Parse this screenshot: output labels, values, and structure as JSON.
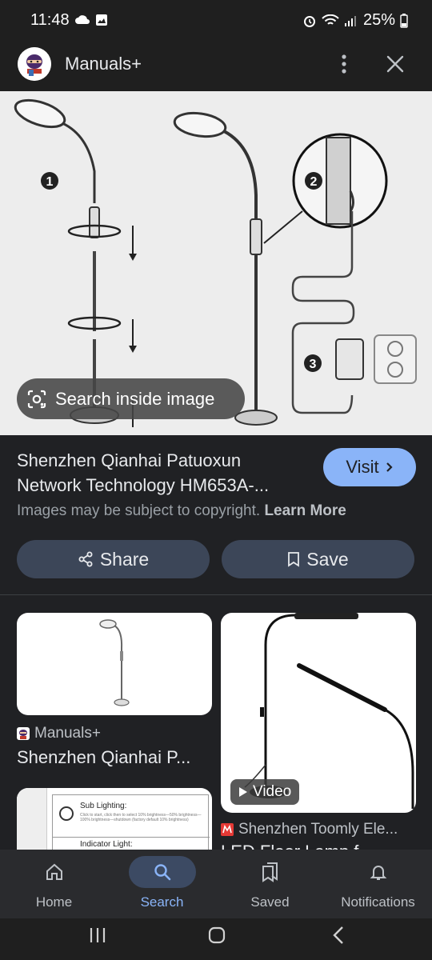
{
  "status_bar": {
    "time": "11:48",
    "battery": "25%"
  },
  "header": {
    "title": "Manuals+"
  },
  "hero": {
    "search_inside_label": "Search inside image",
    "step_labels": [
      "1",
      "2",
      "3"
    ]
  },
  "result": {
    "title_line1": "Shenzhen Qianhai Patuoxun",
    "title_line2": "Network Technology HM653A-...",
    "visit_label": "Visit",
    "copyright_text": "Images may be subject to copyright.",
    "learn_more": "Learn More",
    "share_label": "Share",
    "save_label": "Save"
  },
  "related": [
    {
      "source": "Manuals+",
      "title": "Shenzhen Qianhai P..."
    },
    {
      "source": "Shenzhen Toomly Ele...",
      "title": "LED Floor Lamp f...",
      "badge": "Video"
    },
    {
      "manual_heading1": "Sub Lighting:",
      "manual_body1": "Click to start, click then to select 10% brightness—50% brightness—100% brightness—shutdown (factory default 10% brightness)",
      "manual_heading2": "Indicator Light:"
    }
  ],
  "bottom_nav": [
    {
      "label": "Home",
      "icon": "home-icon"
    },
    {
      "label": "Search",
      "icon": "search-icon",
      "active": true
    },
    {
      "label": "Saved",
      "icon": "bookmarks-icon"
    },
    {
      "label": "Notifications",
      "icon": "bell-icon"
    }
  ],
  "colors": {
    "accent": "#8ab4f8",
    "background": "#202124",
    "pill": "#3c4658"
  }
}
